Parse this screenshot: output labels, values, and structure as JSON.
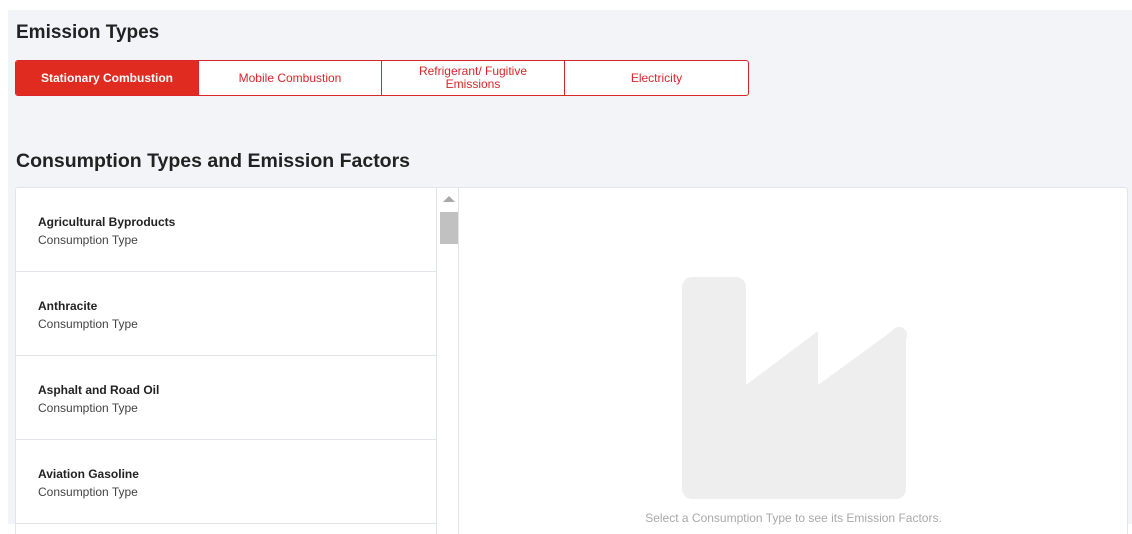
{
  "emission_types": {
    "title": "Emission Types",
    "tabs": [
      {
        "label": "Stationary Combustion",
        "active": true
      },
      {
        "label": "Mobile Combustion",
        "active": false
      },
      {
        "label": "Refrigerant/ Fugitive Emissions",
        "active": false
      },
      {
        "label": "Electricity",
        "active": false
      }
    ]
  },
  "consumption": {
    "title": "Consumption Types and Emission Factors",
    "items": [
      {
        "name": "Agricultural Byproducts",
        "subtitle": "Consumption Type"
      },
      {
        "name": "Anthracite",
        "subtitle": "Consumption Type"
      },
      {
        "name": "Asphalt and Road Oil",
        "subtitle": "Consumption Type"
      },
      {
        "name": "Aviation Gasoline",
        "subtitle": "Consumption Type"
      }
    ],
    "empty_state": {
      "icon": "factory-icon",
      "message": "Select a Consumption Type to see its Emission Factors."
    }
  },
  "colors": {
    "accent": "#df2b20",
    "page_background": "#f2f4f7",
    "placeholder_icon": "#eeeeee"
  }
}
